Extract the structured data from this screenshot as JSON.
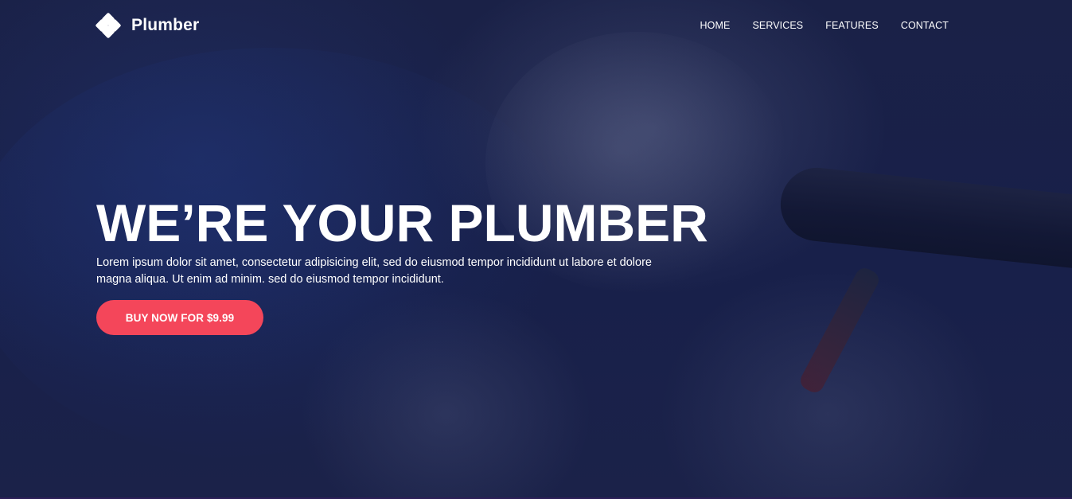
{
  "brand": {
    "name": "Plumber",
    "icon": "four-diamond-logo-icon"
  },
  "nav": {
    "items": [
      {
        "label": "HOME"
      },
      {
        "label": "SERVICES"
      },
      {
        "label": "FEATURES"
      },
      {
        "label": "CONTACT"
      }
    ]
  },
  "hero": {
    "title": "WE’RE YOUR PLUMBER",
    "text": "Lorem ipsum dolor sit amet, consectetur adipisicing elit, sed do eiusmod tempor incididunt ut labore et dolore magna aliqua. Ut enim ad minim. sed do eiusmod tempor incididunt.",
    "cta_label": "BUY NOW FOR $9.99"
  },
  "colors": {
    "overlay": "#1a2147",
    "accent": "#f4465a",
    "text": "#ffffff"
  }
}
